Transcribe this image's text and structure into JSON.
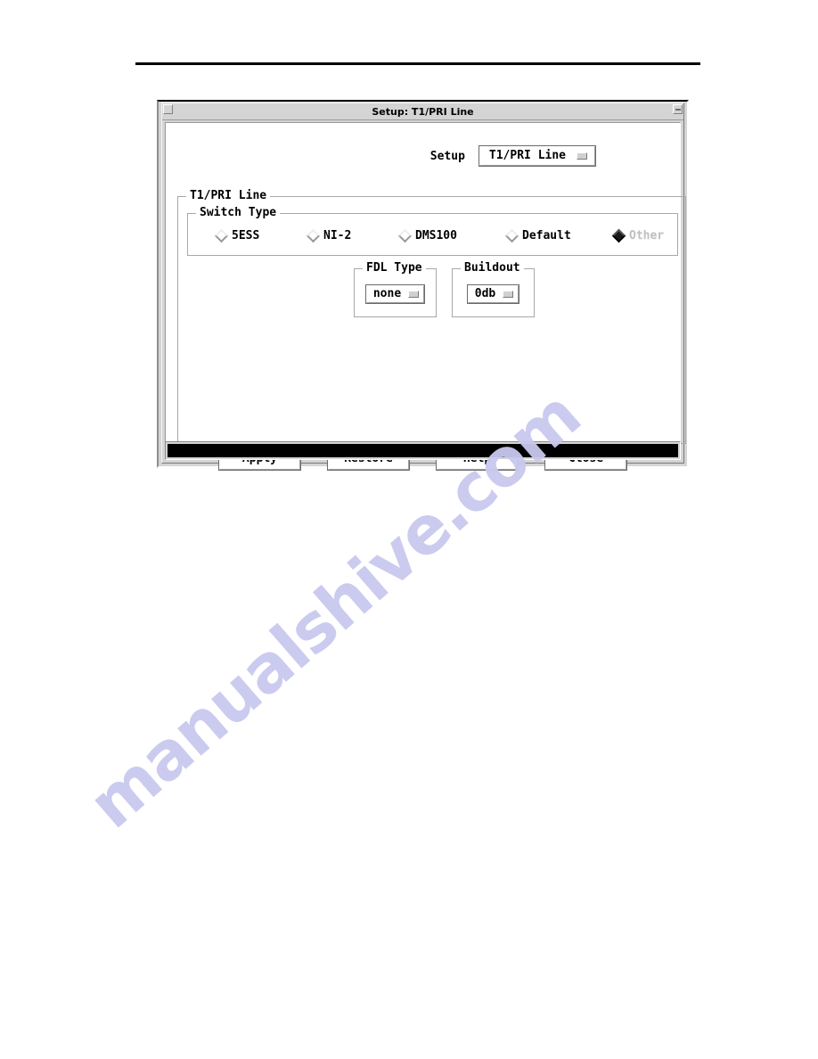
{
  "page": {
    "has_header_rule": true
  },
  "watermark": {
    "text": "manualshive.com"
  },
  "window": {
    "title": "Setup: T1/PRI Line",
    "grip_left_icon": "window-menu-icon",
    "grip_right_icon": "window-resize-icon"
  },
  "setup": {
    "label": "Setup",
    "option_value": "T1/PRI Line",
    "indicator_icon": "option-menu-indicator-icon"
  },
  "t1pri_frame": {
    "title": "T1/PRI Line"
  },
  "switch_type": {
    "title": "Switch Type",
    "options": [
      {
        "label": "5ESS",
        "selected": false,
        "dimmed": false
      },
      {
        "label": "NI-2",
        "selected": false,
        "dimmed": false
      },
      {
        "label": "DMS100",
        "selected": false,
        "dimmed": false
      },
      {
        "label": "Default",
        "selected": false,
        "dimmed": false
      },
      {
        "label": "Other",
        "selected": true,
        "dimmed": true
      }
    ]
  },
  "fdl_type": {
    "title": "FDL Type",
    "value": "none",
    "indicator_icon": "option-menu-indicator-icon"
  },
  "buildout": {
    "title": "Buildout",
    "value": "0db",
    "indicator_icon": "option-menu-indicator-icon"
  },
  "buttons": {
    "apply": "Apply",
    "restore": "Restore",
    "help": "Help",
    "close": "Close"
  },
  "statusbar": {
    "text": ""
  }
}
